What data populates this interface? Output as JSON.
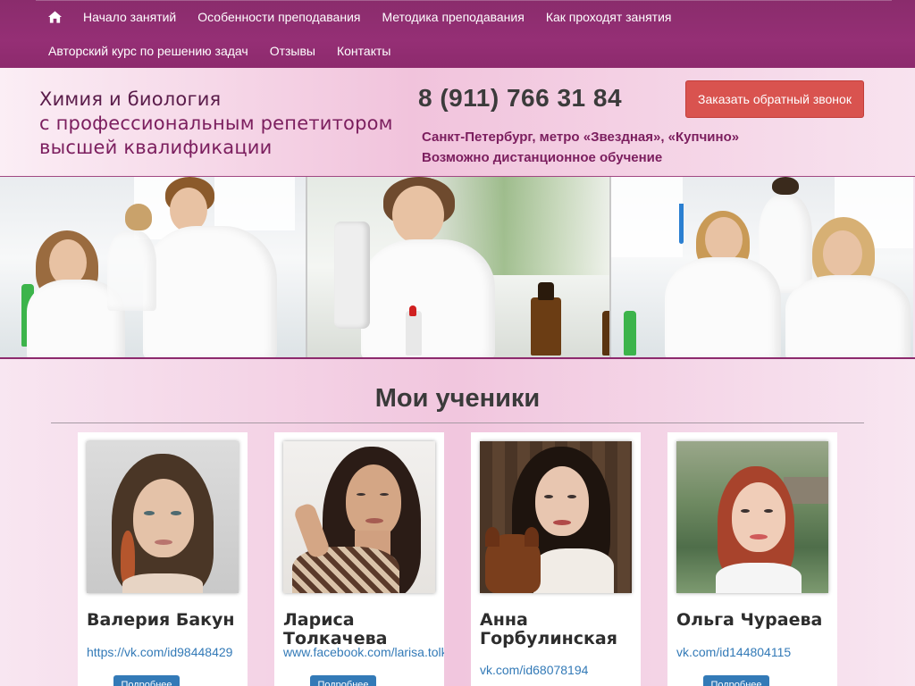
{
  "nav": {
    "row1": [
      "Начало занятий",
      "Особенности преподавания",
      "Методика преподавания",
      "Как проходят занятия"
    ],
    "row2": [
      "Авторский курс по решению задач",
      "Отзывы",
      "Контакты"
    ],
    "home_icon": "home-icon"
  },
  "header": {
    "logo_line1": "Химия и биология",
    "logo_line2": "с профессиональным репетитором",
    "logo_line3": "высшей квалификации",
    "phone": "8 (911) 766 31 84",
    "callback_button": "Заказать обратный звонок",
    "location_line1": "Санкт-Петербург, метро «Звездная», «Купчино»",
    "location_line2": "Возможно дистанционное обучение"
  },
  "students_section": {
    "title": "Мои ученики",
    "students": [
      {
        "name": "Валерия Бакун",
        "link": "https://vk.com/id98448429",
        "button": "Подробнее"
      },
      {
        "name": "Лариса Толкачева",
        "link": "www.facebook.com/larisa.tolkacheva",
        "button": "Подробнее"
      },
      {
        "name": "Анна Горбулинская",
        "link": "vk.com/id68078194",
        "button": "Подробнее"
      },
      {
        "name": "Ольга Чураева",
        "link": "vk.com/id144804115",
        "button": "Подробнее"
      }
    ]
  },
  "colors": {
    "nav_bg": "#8d2a6d",
    "brand_text": "#7b1e5e",
    "callback_button": "#d9534f",
    "link": "#337ab7",
    "more_button": "#337ab7"
  }
}
